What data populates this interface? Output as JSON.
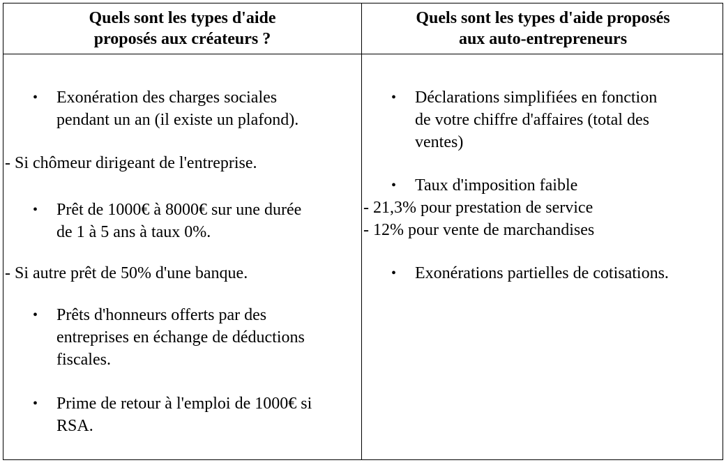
{
  "header": {
    "left": [
      "Quels sont les types d'aide",
      "proposés aux créateurs ?"
    ],
    "right": [
      "Quels sont les types d'aide proposés",
      "aux auto-entrepreneurs"
    ]
  },
  "left_column": {
    "bullet_1": [
      "Exonération des charges sociales",
      "pendant un an (il existe un plafond)."
    ],
    "note_1": "- Si chômeur dirigeant de l'entreprise.",
    "bullet_2": [
      "Prêt de 1000€ à 8000€ sur une durée",
      "de 1 à 5 ans à taux 0%."
    ],
    "note_2": "- Si autre prêt de 50% d'une banque.",
    "bullet_3": [
      "Prêts d'honneurs offerts par des",
      "entreprises en échange de déductions",
      "fiscales."
    ],
    "bullet_4": [
      "Prime de retour à l'emploi de 1000€ si",
      "RSA."
    ]
  },
  "right_column": {
    "bullet_1": [
      "Déclarations simplifiées en fonction",
      "de votre chiffre d'affaires (total des",
      "ventes)"
    ],
    "bullet_2": [
      "Taux d'imposition faible"
    ],
    "note_1": "- 21,3% pour prestation de service",
    "note_2": "- 12% pour vente de marchandises",
    "bullet_3": [
      "Exonérations partielles de cotisations."
    ]
  },
  "bullet_glyph": "•"
}
